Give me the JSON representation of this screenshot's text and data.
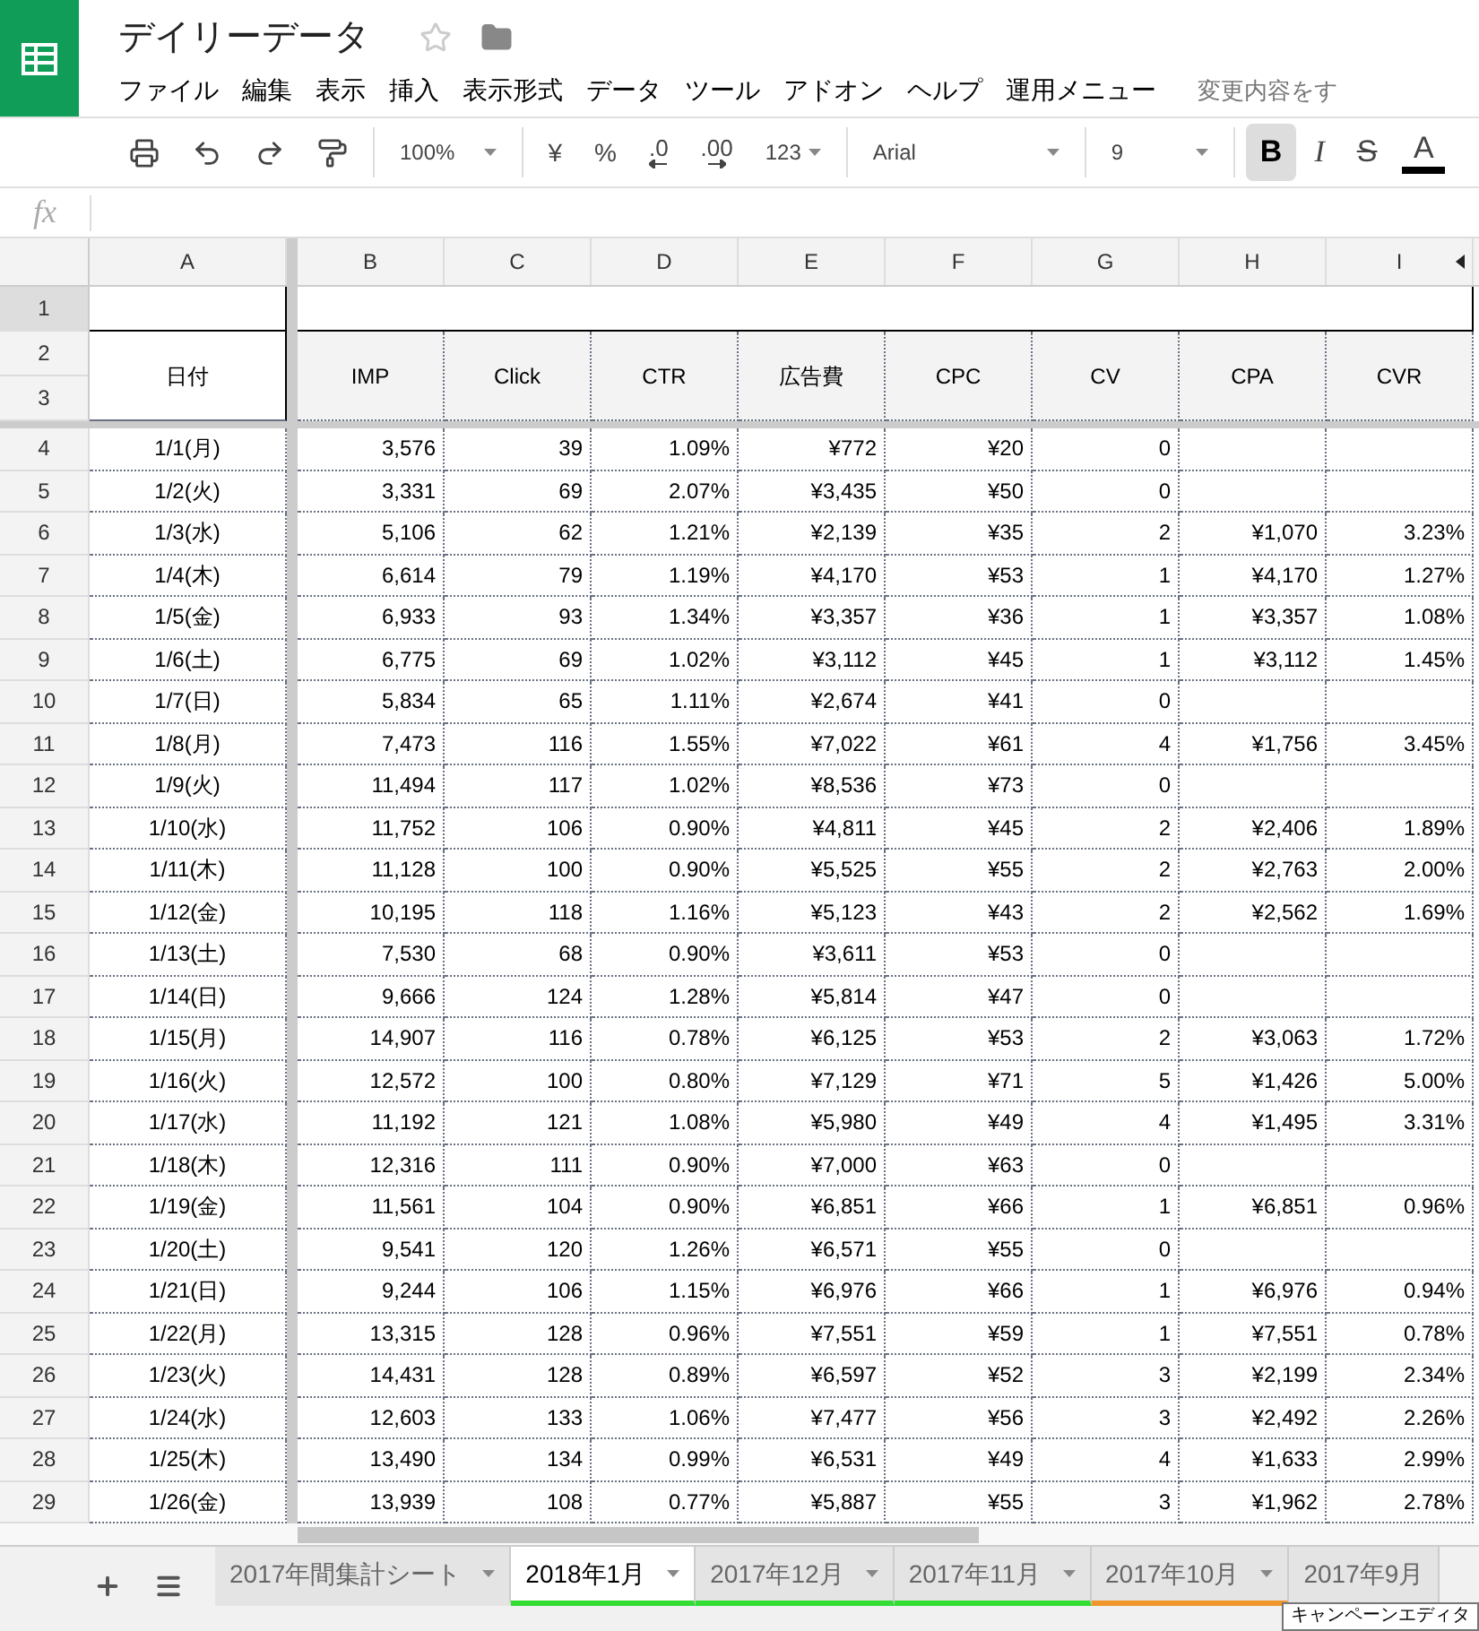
{
  "title": "デイリーデータ",
  "menu": [
    "ファイル",
    "編集",
    "表示",
    "挿入",
    "表示形式",
    "データ",
    "ツール",
    "アドオン",
    "ヘルプ",
    "運用メニュー"
  ],
  "save_status": "変更内容をす",
  "toolbar": {
    "zoom": "100%",
    "currency": "¥",
    "percent": "%",
    "decrease_decimal": ".0",
    "increase_decimal": ".00",
    "number_format": "123",
    "font": "Arial",
    "font_size": "9",
    "bold": {
      "label": "B",
      "selected": true
    },
    "italic": {
      "label": "I",
      "selected": false
    },
    "strikethrough": {
      "label": "S",
      "selected": false
    },
    "text_color": {
      "label": "A",
      "color": "#000000"
    }
  },
  "formula_bar": {
    "label": "fx"
  },
  "columns": [
    "A",
    "B",
    "C",
    "D",
    "E",
    "F",
    "G",
    "H",
    "I"
  ],
  "header_row_numbers": [
    "1",
    "2",
    "3"
  ],
  "headers": [
    "日付",
    "IMP",
    "Click",
    "CTR",
    "広告費",
    "CPC",
    "CV",
    "CPA",
    "CVR"
  ],
  "rows": [
    {
      "n": "4",
      "cells": [
        "1/1(月)",
        "3,576",
        "39",
        "1.09%",
        "¥772",
        "¥20",
        "0"
      ]
    },
    {
      "n": "5",
      "cells": [
        "1/2(火)",
        "3,331",
        "69",
        "2.07%",
        "¥3,435",
        "¥50",
        "0"
      ]
    },
    {
      "n": "6",
      "cells": [
        "1/3(水)",
        "5,106",
        "62",
        "1.21%",
        "¥2,139",
        "¥35",
        "2",
        "¥1,070",
        "3.23%"
      ]
    },
    {
      "n": "7",
      "cells": [
        "1/4(木)",
        "6,614",
        "79",
        "1.19%",
        "¥4,170",
        "¥53",
        "1",
        "¥4,170",
        "1.27%"
      ]
    },
    {
      "n": "8",
      "cells": [
        "1/5(金)",
        "6,933",
        "93",
        "1.34%",
        "¥3,357",
        "¥36",
        "1",
        "¥3,357",
        "1.08%"
      ]
    },
    {
      "n": "9",
      "cells": [
        "1/6(土)",
        "6,775",
        "69",
        "1.02%",
        "¥3,112",
        "¥45",
        "1",
        "¥3,112",
        "1.45%"
      ]
    },
    {
      "n": "10",
      "cells": [
        "1/7(日)",
        "5,834",
        "65",
        "1.11%",
        "¥2,674",
        "¥41",
        "0"
      ]
    },
    {
      "n": "11",
      "cells": [
        "1/8(月)",
        "7,473",
        "116",
        "1.55%",
        "¥7,022",
        "¥61",
        "4",
        "¥1,756",
        "3.45%"
      ]
    },
    {
      "n": "12",
      "cells": [
        "1/9(火)",
        "11,494",
        "117",
        "1.02%",
        "¥8,536",
        "¥73",
        "0"
      ]
    },
    {
      "n": "13",
      "cells": [
        "1/10(水)",
        "11,752",
        "106",
        "0.90%",
        "¥4,811",
        "¥45",
        "2",
        "¥2,406",
        "1.89%"
      ]
    },
    {
      "n": "14",
      "cells": [
        "1/11(木)",
        "11,128",
        "100",
        "0.90%",
        "¥5,525",
        "¥55",
        "2",
        "¥2,763",
        "2.00%"
      ]
    },
    {
      "n": "15",
      "cells": [
        "1/12(金)",
        "10,195",
        "118",
        "1.16%",
        "¥5,123",
        "¥43",
        "2",
        "¥2,562",
        "1.69%"
      ]
    },
    {
      "n": "16",
      "cells": [
        "1/13(土)",
        "7,530",
        "68",
        "0.90%",
        "¥3,611",
        "¥53",
        "0"
      ]
    },
    {
      "n": "17",
      "cells": [
        "1/14(日)",
        "9,666",
        "124",
        "1.28%",
        "¥5,814",
        "¥47",
        "0"
      ]
    },
    {
      "n": "18",
      "cells": [
        "1/15(月)",
        "14,907",
        "116",
        "0.78%",
        "¥6,125",
        "¥53",
        "2",
        "¥3,063",
        "1.72%"
      ]
    },
    {
      "n": "19",
      "cells": [
        "1/16(火)",
        "12,572",
        "100",
        "0.80%",
        "¥7,129",
        "¥71",
        "5",
        "¥1,426",
        "5.00%"
      ]
    },
    {
      "n": "20",
      "cells": [
        "1/17(水)",
        "11,192",
        "121",
        "1.08%",
        "¥5,980",
        "¥49",
        "4",
        "¥1,495",
        "3.31%"
      ]
    },
    {
      "n": "21",
      "cells": [
        "1/18(木)",
        "12,316",
        "111",
        "0.90%",
        "¥7,000",
        "¥63",
        "0"
      ]
    },
    {
      "n": "22",
      "cells": [
        "1/19(金)",
        "11,561",
        "104",
        "0.90%",
        "¥6,851",
        "¥66",
        "1",
        "¥6,851",
        "0.96%"
      ]
    },
    {
      "n": "23",
      "cells": [
        "1/20(土)",
        "9,541",
        "120",
        "1.26%",
        "¥6,571",
        "¥55",
        "0"
      ]
    },
    {
      "n": "24",
      "cells": [
        "1/21(日)",
        "9,244",
        "106",
        "1.15%",
        "¥6,976",
        "¥66",
        "1",
        "¥6,976",
        "0.94%"
      ]
    },
    {
      "n": "25",
      "cells": [
        "1/22(月)",
        "13,315",
        "128",
        "0.96%",
        "¥7,551",
        "¥59",
        "1",
        "¥7,551",
        "0.78%"
      ]
    },
    {
      "n": "26",
      "cells": [
        "1/23(火)",
        "14,431",
        "128",
        "0.89%",
        "¥6,597",
        "¥52",
        "3",
        "¥2,199",
        "2.34%"
      ]
    },
    {
      "n": "27",
      "cells": [
        "1/24(水)",
        "12,603",
        "133",
        "1.06%",
        "¥7,477",
        "¥56",
        "3",
        "¥2,492",
        "2.26%"
      ]
    },
    {
      "n": "28",
      "cells": [
        "1/25(木)",
        "13,490",
        "134",
        "0.99%",
        "¥6,531",
        "¥49",
        "4",
        "¥1,633",
        "2.99%"
      ]
    },
    {
      "n": "29",
      "cells": [
        "1/26(金)",
        "13,939",
        "108",
        "0.77%",
        "¥5,887",
        "¥55",
        "3",
        "¥1,962",
        "2.78%"
      ]
    }
  ],
  "sheet_tabs": [
    {
      "label": "2017年間集計シート",
      "selected": false
    },
    {
      "label": "2018年1月",
      "selected": true,
      "color": "#33dd33"
    },
    {
      "label": "2017年12月",
      "selected": false,
      "color": "#33dd33"
    },
    {
      "label": "2017年11月",
      "selected": false,
      "color": "#33dd33"
    },
    {
      "label": "2017年10月",
      "selected": false,
      "color": "#f0962a"
    },
    {
      "label": "2017年9月",
      "selected": false
    }
  ],
  "tooltip": "キャンペーンエディタ"
}
